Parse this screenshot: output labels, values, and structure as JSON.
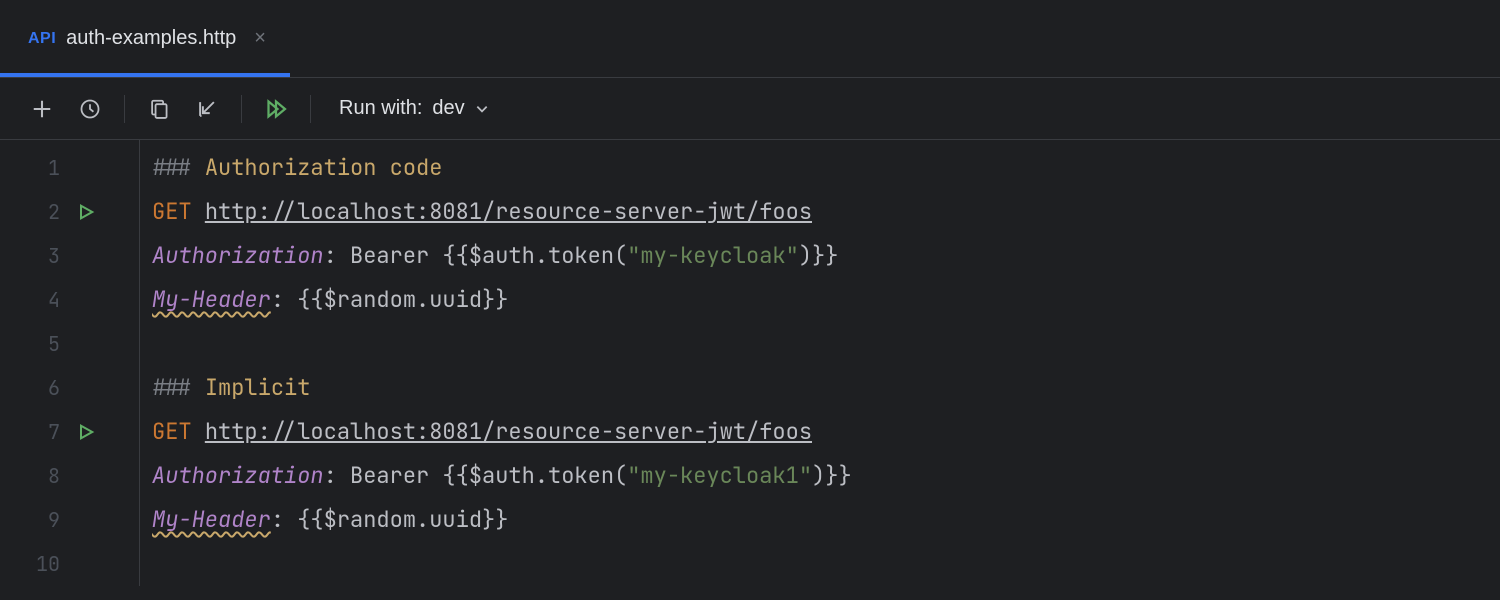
{
  "tab": {
    "badge": "API",
    "filename": "auth-examples.http"
  },
  "toolbar": {
    "runWithLabel": "Run with:",
    "environment": "dev"
  },
  "editor": {
    "lines": [
      {
        "num": "1",
        "type": "section",
        "hash": "### ",
        "title": "Authorization code"
      },
      {
        "num": "2",
        "type": "request",
        "gutter": "run",
        "method": "GET ",
        "url": "http://localhost:8081/resource-server-jwt/foos"
      },
      {
        "num": "3",
        "type": "header",
        "name": "Authorization",
        "colon": ": ",
        "prefix": "Bearer ",
        "open": "{{",
        "expr": "$auth.token(",
        "str": "\"my-keycloak\"",
        "after": ")",
        "close": "}}"
      },
      {
        "num": "4",
        "type": "header-warn",
        "name": "My-Header",
        "colon": ": ",
        "open": "{{",
        "expr": "$random.uuid",
        "close": "}}"
      },
      {
        "num": "5",
        "type": "blank"
      },
      {
        "num": "6",
        "type": "section",
        "hash": "### ",
        "title": "Implicit"
      },
      {
        "num": "7",
        "type": "request",
        "gutter": "run",
        "method": "GET ",
        "url": "http://localhost:8081/resource-server-jwt/foos"
      },
      {
        "num": "8",
        "type": "header",
        "name": "Authorization",
        "colon": ": ",
        "prefix": "Bearer ",
        "open": "{{",
        "expr": "$auth.token(",
        "str": "\"my-keycloak1\"",
        "after": ")",
        "close": "}}"
      },
      {
        "num": "9",
        "type": "header-warn",
        "name": "My-Header",
        "colon": ": ",
        "open": "{{",
        "expr": "$random.uuid",
        "close": "}}"
      },
      {
        "num": "10",
        "type": "blank"
      }
    ]
  }
}
